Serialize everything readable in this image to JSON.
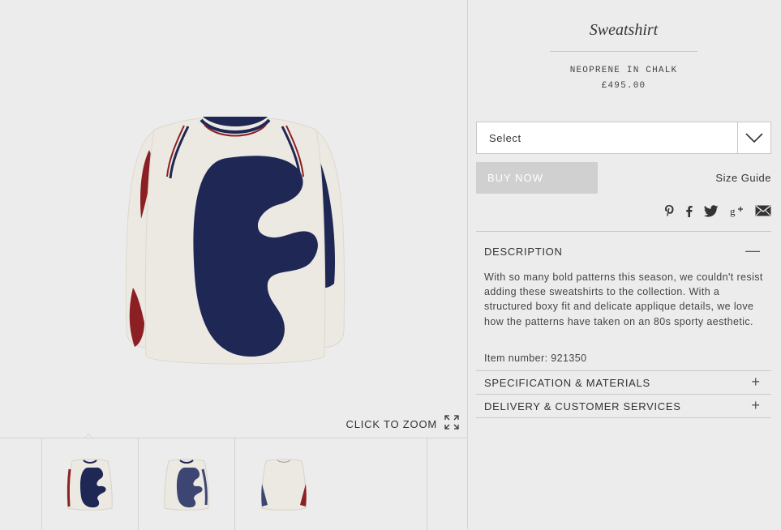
{
  "product": {
    "title": "Sweatshirt",
    "subtitle": "NEOPRENE IN CHALK",
    "price": "£495.00",
    "size_select": {
      "selected": "Select"
    },
    "buy_label": "BUY NOW",
    "size_guide_label": "Size Guide",
    "share_icons": [
      "pinterest-icon",
      "facebook-icon",
      "twitter-icon",
      "google-plus-icon",
      "email-icon"
    ]
  },
  "gallery": {
    "zoom_label": "CLICK TO ZOOM",
    "thumbnails": [
      "front view",
      "front view alternate",
      "back view"
    ]
  },
  "accordion": {
    "description": {
      "label": "DESCRIPTION",
      "sign": "—",
      "text": "With so many bold patterns this season, we couldn't resist adding these sweatshirts to the collection. With a structured boxy fit and delicate applique details, we love how the patterns have taken on an 80s sporty aesthetic.",
      "item_number": "Item number: 921350"
    },
    "specification": {
      "label": "SPECIFICATION & MATERIALS",
      "sign": "+"
    },
    "delivery": {
      "label": "DELIVERY & CUSTOMER SERVICES",
      "sign": "+"
    }
  },
  "colors": {
    "background": "#ececec",
    "navy": "#1f2755",
    "chalk": "#ece9e2",
    "burgundy": "#8b1f24",
    "buy_disabled": "#d0d0d0"
  }
}
